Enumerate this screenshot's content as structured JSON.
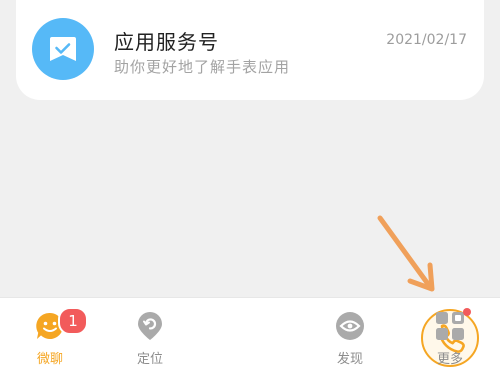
{
  "card": {
    "title": "应用服务号",
    "subtitle": "助你更好地了解手表应用",
    "date": "2021/02/17",
    "icon": "service-account-icon"
  },
  "tabs": [
    {
      "label": "微聊",
      "icon": "chat-icon",
      "badge": "1",
      "active": true
    },
    {
      "label": "定位",
      "icon": "location-icon",
      "active": false
    },
    {
      "label": "",
      "icon": "phone-icon",
      "active": false
    },
    {
      "label": "发现",
      "icon": "discover-icon",
      "active": false
    },
    {
      "label": "更多",
      "icon": "more-grid-icon",
      "dot": true,
      "active": false
    }
  ],
  "colors": {
    "accent": "#f5a623",
    "icon_gray": "#aaaaaa",
    "badge_red": "#f25b5b",
    "card_icon_blue": "#56b9f7",
    "annotation_arrow": "#f0a05a"
  }
}
